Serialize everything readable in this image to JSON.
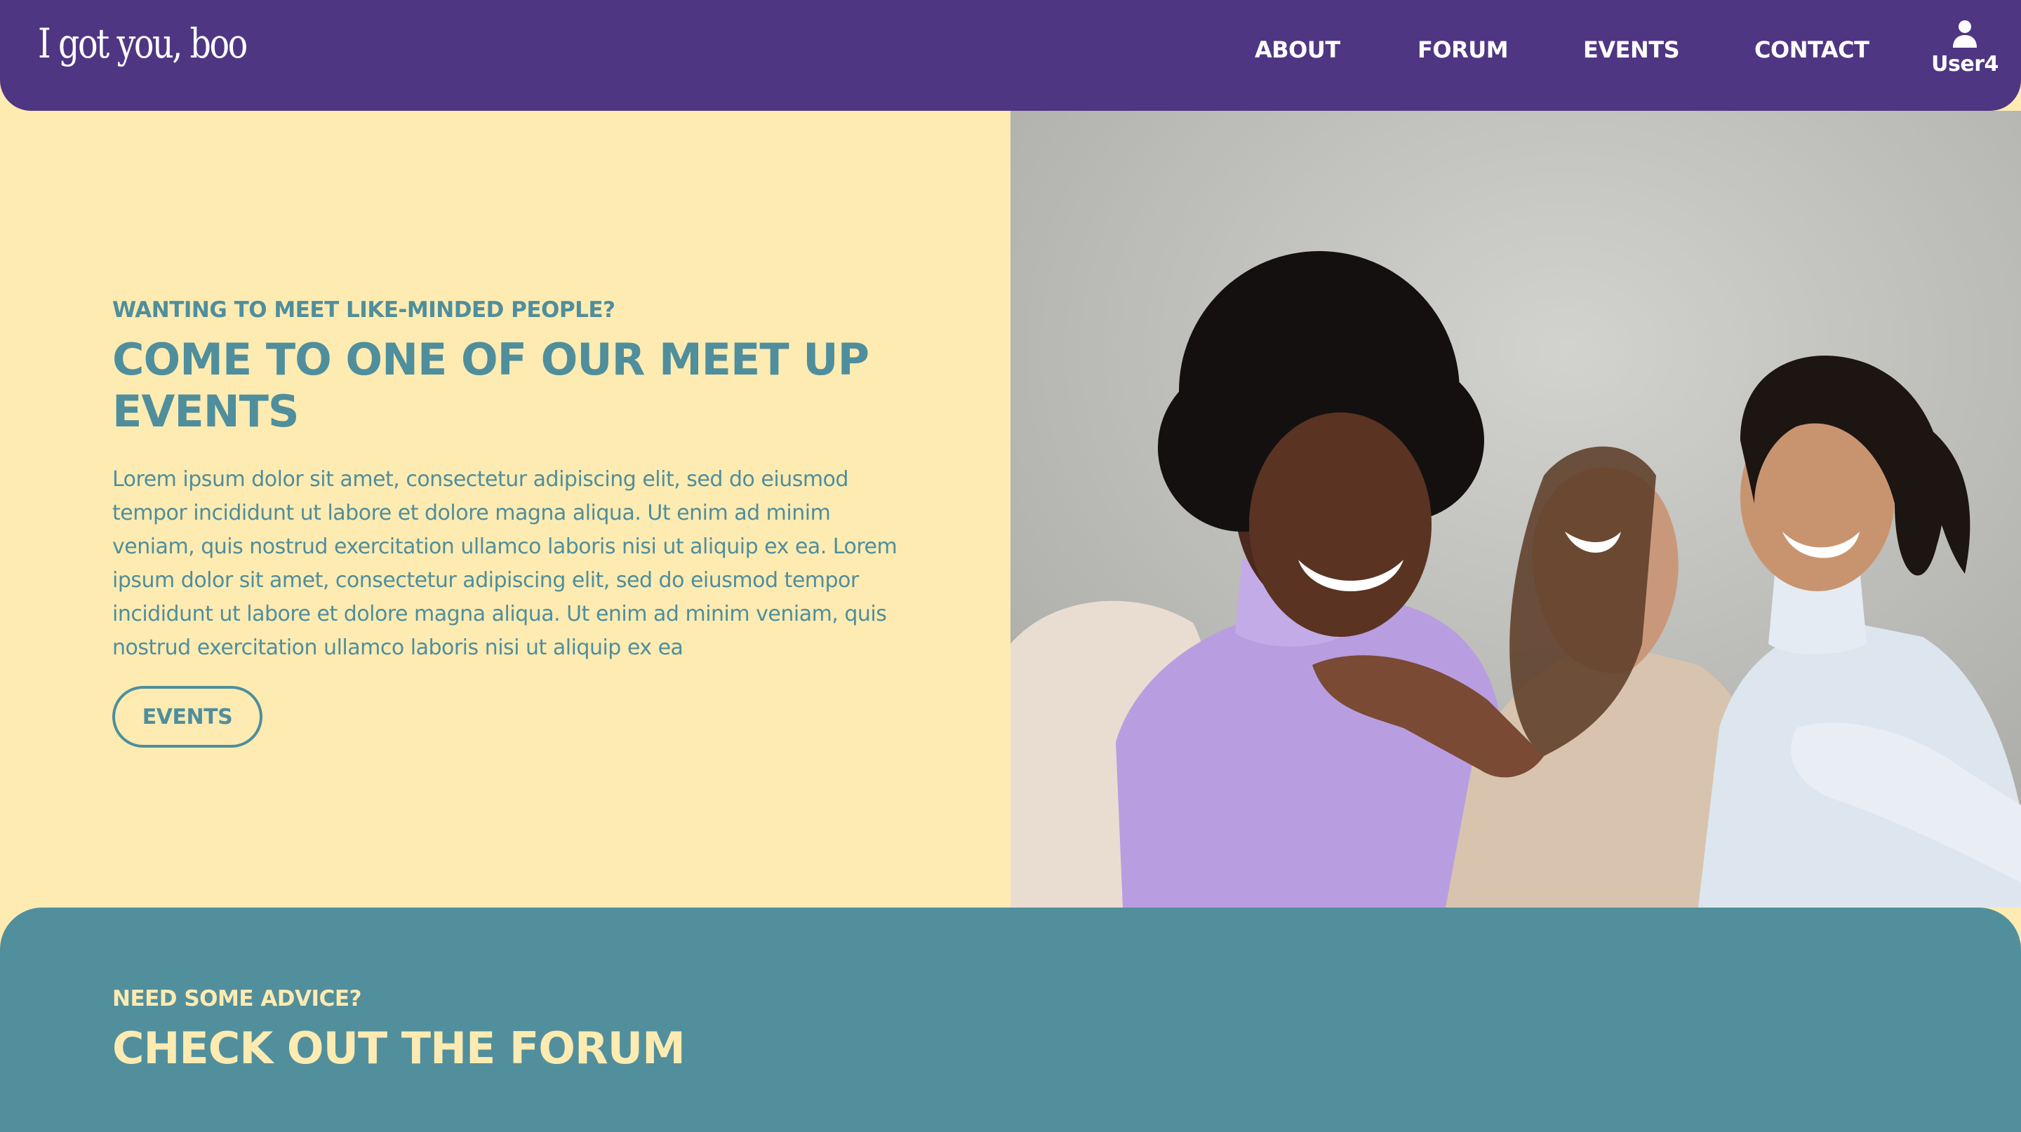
{
  "header": {
    "logo": "I got you, boo",
    "nav": [
      "ABOUT",
      "FORUM",
      "EVENTS",
      "CONTACT"
    ],
    "user": {
      "icon": "user-icon",
      "name": "User4"
    }
  },
  "hero": {
    "eyebrow": "WANTING TO MEET LIKE-MINDED PEOPLE?",
    "heading": "COME TO ONE OF OUR MEET UP EVENTS",
    "body": "Lorem ipsum dolor sit amet, consectetur adipiscing elit, sed do eiusmod tempor incididunt ut labore et dolore magna aliqua. Ut enim ad minim veniam, quis nostrud exercitation ullamco laboris nisi ut aliquip ex ea. Lorem ipsum dolor sit amet, consectetur adipiscing elit, sed do eiusmod tempor incididunt ut labore et dolore magna aliqua. Ut enim ad minim veniam, quis nostrud exercitation ullamco laboris nisi ut aliquip ex ea",
    "button": "EVENTS"
  },
  "forum": {
    "eyebrow": "NEED SOME ADVICE?",
    "heading": "CHECK OUT THE FORUM"
  },
  "colors": {
    "header_bg": "#4f3683",
    "cream": "#fdebb2",
    "teal": "#4f8e9c",
    "forum_bg": "#528f9c"
  }
}
